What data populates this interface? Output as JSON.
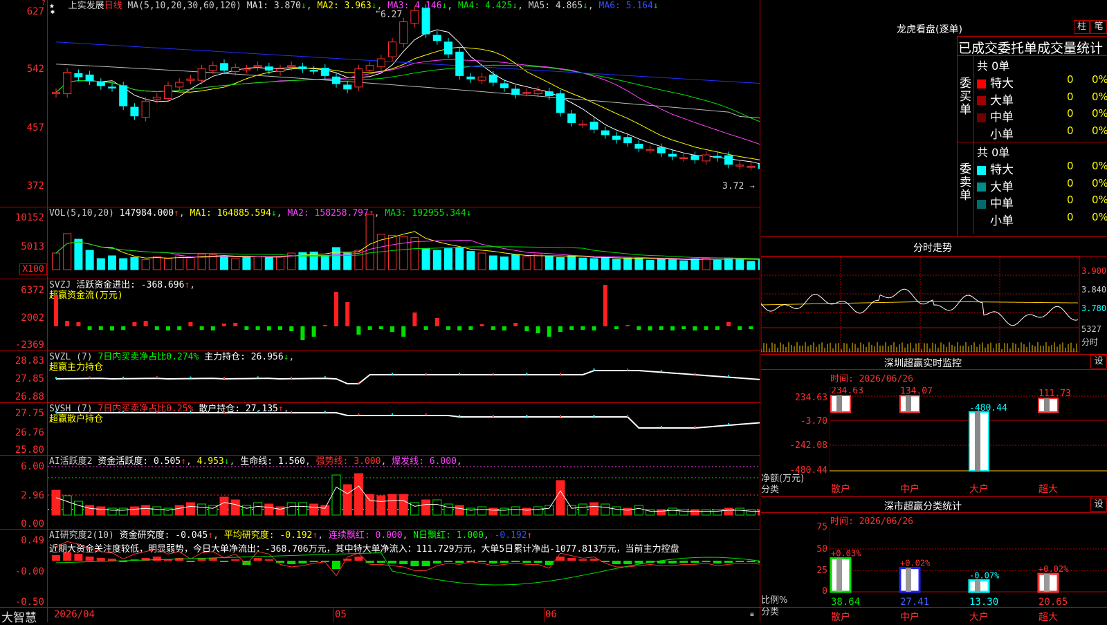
{
  "app": {
    "name": "大智慧"
  },
  "stock": {
    "name": "上实发展",
    "period": "日线"
  },
  "kline": {
    "ma_label": "MA(5,10,20,30,60,120)",
    "ma1": "MA1: 3.870",
    "ma2": "MA2: 3.963",
    "ma3": "MA3: 4.146",
    "ma4": "MA4: 4.425",
    "ma5": "MA5: 4.865",
    "ma6": "MA6: 5.164",
    "high_label": "6.27",
    "low_label": "3.72",
    "y_labels": [
      "627",
      "542",
      "457",
      "372"
    ],
    "arrow_down": "↓"
  },
  "volume": {
    "label": "VOL(5,10,20)",
    "value": "147984.000",
    "ma1": "MA1: 164885.594",
    "ma2": "MA2: 158258.797",
    "ma3": "MA3: 192955.344",
    "y_labels": [
      "10152",
      "5013",
      "X100"
    ],
    "up": "↑",
    "down": "↓"
  },
  "svzj": {
    "label": "SVZJ",
    "desc": "活跃资金进出: -368.696",
    "sub": "超赢资金流(万元)",
    "y_labels": [
      "6372",
      "2002",
      "-2369"
    ]
  },
  "svzl": {
    "label": "SVZL (7)",
    "desc": "7日内买卖净占比0.274%",
    "pos": "主力持仓: 26.956",
    "sub": "超赢主力持仓",
    "y_labels": [
      "28.83",
      "27.85",
      "26.88"
    ]
  },
  "svsh": {
    "label": "SVSH (7)",
    "desc": "7日内买卖净占比0.25%",
    "pos": "散户持仓: 27.135",
    "sub": "超赢散户持仓",
    "y_labels": [
      "27.75",
      "26.76",
      "25.80"
    ]
  },
  "ai1": {
    "label": "AI活跃度2",
    "v1": "资金活跃度: 0.505",
    "v2": "4.953",
    "v3": "生命线: 1.560",
    "v4": "强势线: 3.000",
    "v5": "爆发线: 6.000",
    "y_labels": [
      "6.00",
      "2.96",
      "0.00"
    ]
  },
  "ai2": {
    "label": "AI研究度2(10)",
    "v1": "资金研究度: -0.045",
    "v2": "平均研究度: -0.192",
    "v3": "连续飘红: 0.000",
    "v4": "N日飘红: 1.000",
    "v5": "-0.192",
    "text": "近期大资金关注度较低，明显弱势，今日大单净流出：-368.706万元，其中特大单净流入：111.729万元，大单5日累计净出-1077.813万元，当前主力控盘",
    "y_labels": [
      "0.49",
      "-0.00",
      "-0.50"
    ]
  },
  "time_axis": {
    "labels": [
      "2026/04",
      "05",
      "06"
    ]
  },
  "longhu": {
    "title": "龙虎看盘(逐单)",
    "btn_bar": "柱",
    "btn_count": "笔",
    "stats_title": "已成交委托单成交量统计",
    "buy": {
      "label": "委买单",
      "total": "共 0单",
      "rows": [
        {
          "name": "特大",
          "count": "0",
          "pct": "0%",
          "color": "#ff0000"
        },
        {
          "name": "大单",
          "count": "0",
          "pct": "0%",
          "color": "#a00000"
        },
        {
          "name": "中单",
          "count": "0",
          "pct": "0%",
          "color": "#700000"
        },
        {
          "name": "小单",
          "count": "0",
          "pct": "0%",
          "color": ""
        }
      ]
    },
    "sell": {
      "label": "委卖单",
      "total": "共 0单",
      "rows": [
        {
          "name": "特大",
          "count": "0",
          "pct": "0%",
          "color": "#00ffff"
        },
        {
          "name": "大单",
          "count": "0",
          "pct": "0%",
          "color": "#008b8b"
        },
        {
          "name": "中单",
          "count": "0",
          "pct": "0%",
          "color": "#006b6b"
        },
        {
          "name": "小单",
          "count": "0",
          "pct": "0%",
          "color": ""
        }
      ]
    }
  },
  "intraday": {
    "title": "分时走势",
    "y_labels": [
      "3.900",
      "3.840",
      "3.780"
    ],
    "vol_label": "5327",
    "vol_unit": "分时"
  },
  "monitor": {
    "title": "深圳超赢实时监控",
    "btn": "设",
    "date": "时间: 2026/06/26",
    "y_labels": [
      "234.63",
      "-3.70",
      "-242.08",
      "-480.44"
    ],
    "unit": "净额(万元)",
    "unit2": "分类",
    "categories": [
      "散户",
      "中户",
      "大户",
      "超大"
    ],
    "values_text": [
      "234.63",
      "134.07",
      "-480.44",
      "111.73"
    ]
  },
  "classify": {
    "title": "深市超赢分类统计",
    "btn": "设",
    "date": "时间: 2026/06/26",
    "y_labels": [
      "75",
      "50",
      "25",
      "0"
    ],
    "unit": "比例%",
    "unit2": "分类",
    "categories": [
      "散户",
      "中户",
      "大户",
      "超大"
    ],
    "changes": [
      "+0.03%",
      "+0.02%",
      "-0.07%",
      "+0.02%"
    ],
    "values": [
      "38.64",
      "27.41",
      "13.30",
      "20.65"
    ]
  },
  "chart_data": [
    {
      "type": "candlestick",
      "title": "上实发展 日线",
      "y_range": [
        3.72,
        6.27
      ],
      "ma": [
        {
          "name": "MA1",
          "value": 3.87
        },
        {
          "name": "MA2",
          "value": 3.963
        },
        {
          "name": "MA3",
          "value": 4.146
        },
        {
          "name": "MA4",
          "value": 4.425
        },
        {
          "name": "MA5",
          "value": 4.865
        },
        {
          "name": "MA6",
          "value": 5.164
        }
      ],
      "close": [
        5.05,
        5.35,
        5.28,
        5.22,
        5.15,
        5.12,
        4.85,
        4.7,
        4.92,
        4.98,
        5.15,
        5.2,
        5.25,
        5.4,
        5.45,
        5.38,
        5.42,
        5.4,
        5.45,
        5.38,
        5.4,
        5.45,
        5.4,
        5.38,
        5.3,
        5.18,
        5.1,
        5.4,
        5.45,
        5.55,
        5.8,
        6.1,
        6.27,
        5.92,
        5.82,
        5.62,
        5.3,
        5.25,
        5.28,
        5.2,
        5.12,
        5.02,
        5.05,
        5.08,
        5.0,
        4.75,
        4.6,
        4.58,
        4.5,
        4.42,
        4.35,
        4.3,
        4.22,
        4.2,
        4.15,
        4.1,
        4.08,
        4.05,
        4.12,
        4.08,
        3.98,
        3.97,
        3.95,
        3.92,
        3.85,
        3.76
      ]
    },
    {
      "type": "bar",
      "title": "VOL(5,10,20)",
      "values": [
        30,
        65,
        55,
        35,
        20,
        25,
        20,
        22,
        18,
        24,
        20,
        25,
        22,
        28,
        27,
        25,
        20,
        23,
        24,
        22,
        24,
        30,
        31,
        32,
        25,
        40,
        30,
        35,
        100,
        64,
        62,
        60,
        58,
        38,
        35,
        38,
        40,
        33,
        30,
        25,
        23,
        27,
        23,
        28,
        24,
        22,
        25,
        21,
        20,
        22,
        19,
        21,
        21,
        17,
        20,
        18,
        16,
        20,
        21,
        17,
        21,
        20,
        15,
        18,
        15,
        18,
        14
      ]
    },
    {
      "type": "bar",
      "title": "活跃资金进出",
      "y_range": [
        -2369,
        6372
      ]
    },
    {
      "type": "line",
      "title": "主力持仓",
      "y_range": [
        26.88,
        28.83
      ]
    },
    {
      "type": "line",
      "title": "散户持仓",
      "y_range": [
        25.8,
        27.75
      ]
    },
    {
      "type": "bar",
      "title": "资金活跃度",
      "y_range": [
        0,
        6
      ]
    },
    {
      "type": "bar",
      "title": "资金研究度",
      "y_range": [
        -0.5,
        0.49
      ]
    },
    {
      "type": "bar",
      "title": "深圳超赢实时监控",
      "categories": [
        "散户",
        "中户",
        "大户",
        "超大"
      ],
      "values": [
        234.63,
        134.07,
        -480.44,
        111.73
      ],
      "y_range": [
        -480.44,
        234.63
      ]
    },
    {
      "type": "bar",
      "title": "深市超赢分类统计",
      "categories": [
        "散户",
        "中户",
        "大户",
        "超大"
      ],
      "values": [
        38.64,
        27.41,
        13.3,
        20.65
      ],
      "y_range": [
        0,
        75
      ]
    }
  ],
  "colors": {
    "up": "#ff3030",
    "down": "#00ffff",
    "green": "#00e000",
    "grid": "#c00000"
  }
}
